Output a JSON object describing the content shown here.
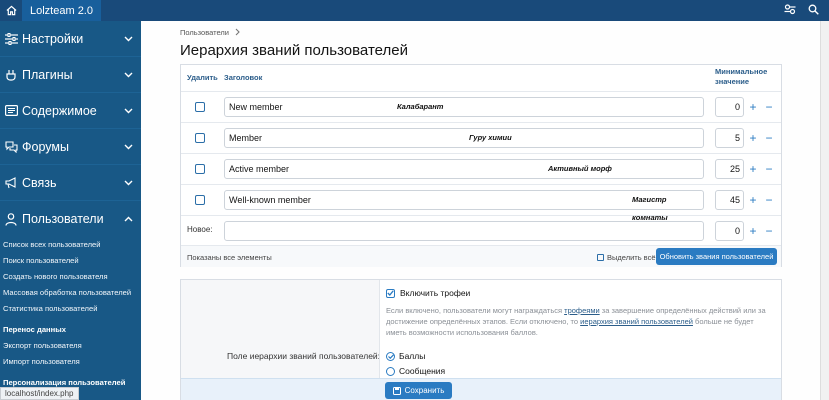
{
  "topbar": {
    "brand": "Lolzteam 2.0"
  },
  "sidebar": {
    "nav": [
      {
        "label": "Настройки",
        "icon": "sliders-icon"
      },
      {
        "label": "Плагины",
        "icon": "plug-icon"
      },
      {
        "label": "Содержимое",
        "icon": "content-icon"
      },
      {
        "label": "Форумы",
        "icon": "forums-icon"
      },
      {
        "label": "Связь",
        "icon": "megaphone-icon"
      },
      {
        "label": "Пользователи",
        "icon": "user-icon"
      }
    ],
    "users_sub": [
      "Список всех пользователей",
      "Поиск пользователей",
      "Создать нового пользователя",
      "Массовая обработка пользователей",
      "Статистика пользователей"
    ],
    "transfer_heading": "Перенос данных",
    "transfer_sub": [
      "Экспорт пользователя",
      "Импорт пользователя"
    ],
    "personalization_heading": "Персонализация пользователей"
  },
  "statusbar": "localhost/index.php",
  "breadcrumb": "Пользователи",
  "page_title": "Иерархия званий пользователей",
  "table": {
    "col_delete": "Удалить",
    "col_title": "Заголовок",
    "col_min": "Минимальное значение",
    "rows": [
      {
        "title": "New member",
        "tag": "Калабарант",
        "min": "0"
      },
      {
        "title": "Member",
        "tag": "Гуру химии",
        "min": "5"
      },
      {
        "title": "Active member",
        "tag": "Активный морф",
        "min": "25"
      },
      {
        "title": "Well-known member",
        "tag": "Магистр комнаты",
        "min": "45"
      }
    ],
    "new_label": "Новое:",
    "new_min": "0",
    "shown_text": "Показаны все элементы",
    "select_all": "Выделить всё",
    "update_button": "Обновить звания пользователей"
  },
  "options": {
    "enable_trophies": "Включить трофеи",
    "hint_before": "Если включено, пользователи могут награждаться ",
    "hint_link1": "трофеями",
    "hint_middle": " за завершение определённых действий или за достижение определённых этапов. Если отключено, то ",
    "hint_link2": "иерархия званий пользователей",
    "hint_after": " больше не будет иметь возможности использования баллов.",
    "field_label": "Поле иерархии званий пользователей:",
    "radio_points": "Баллы",
    "radio_messages": "Сообщения",
    "save_button": "Сохранить"
  }
}
